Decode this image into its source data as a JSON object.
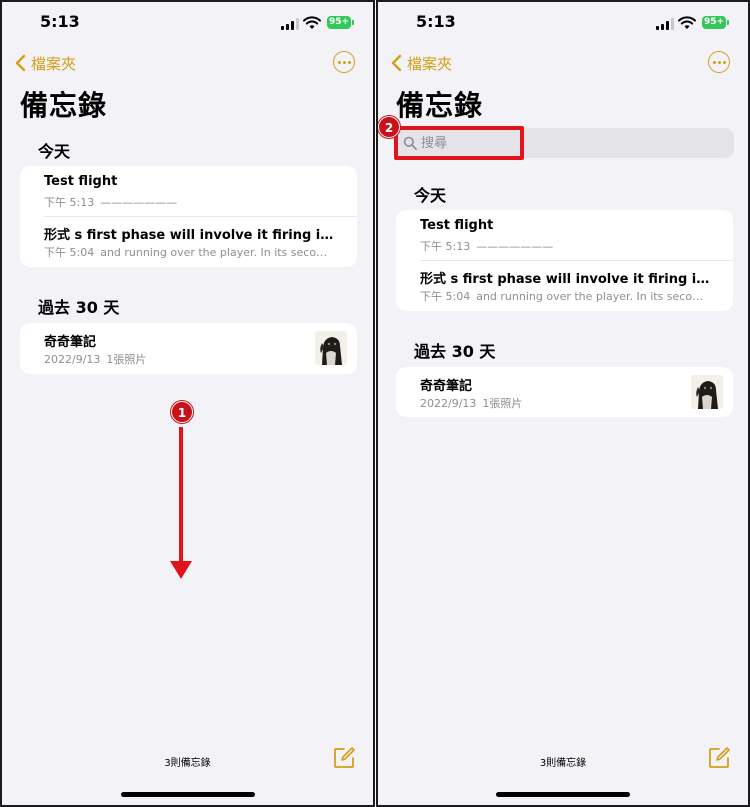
{
  "status_bar": {
    "time": "5:13",
    "battery": "95+"
  },
  "nav": {
    "back_label": "檔案夾"
  },
  "title": "備忘錄",
  "search": {
    "placeholder": "搜尋"
  },
  "sections": {
    "today": {
      "header": "今天",
      "notes": [
        {
          "title": "Test flight",
          "date": "下午 5:13",
          "preview": "———————"
        },
        {
          "title": "形式 s first phase will involve it firing its mai...",
          "date": "下午 5:04",
          "preview": "and running over the player. In its second..."
        }
      ]
    },
    "past30": {
      "header": "過去 30 天",
      "notes": [
        {
          "title": "奇奇筆記",
          "date": "2022/9/13",
          "preview": "1張照片"
        }
      ]
    }
  },
  "footer": {
    "count": "3則備忘錄"
  },
  "annotations": {
    "marker1": "1",
    "marker2": "2"
  },
  "colors": {
    "accent": "#d4a017",
    "annotation_red": "#e0141a",
    "background": "#f2f2f7"
  },
  "icons": [
    "chevron-left-icon",
    "more-icon",
    "search-icon",
    "compose-icon",
    "signal-icon",
    "wifi-icon",
    "battery-icon"
  ]
}
